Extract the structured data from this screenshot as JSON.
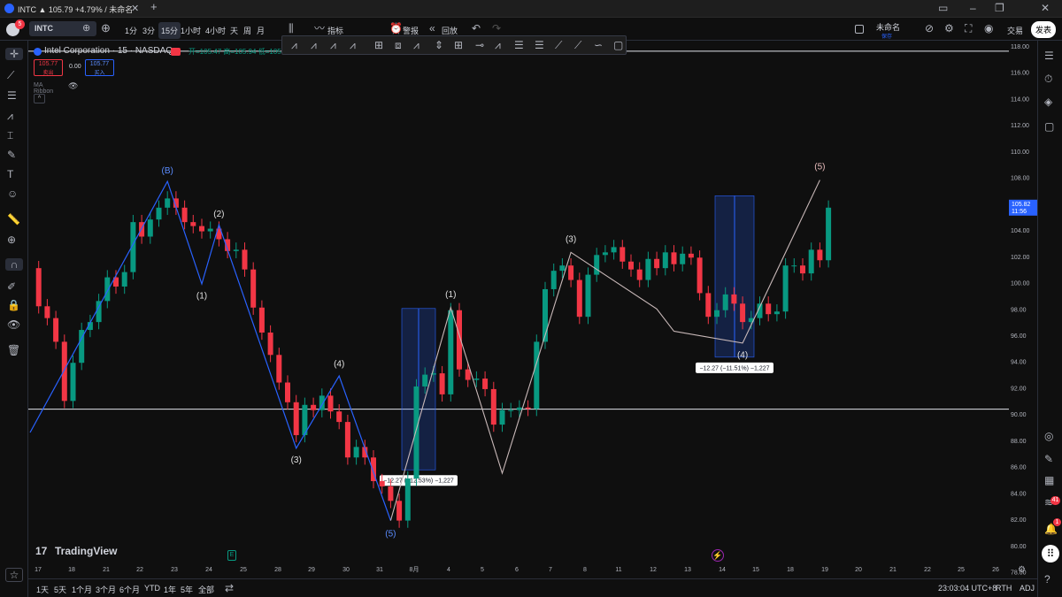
{
  "titlebar": {
    "tab_title": "INTC ▲ 105.79 +4.79% / 未命名",
    "logo": "tradingview-logo-icon"
  },
  "toolbar": {
    "symbol": "INTC",
    "notification_count": "5",
    "intervals": [
      "1分",
      "3分",
      "15分",
      "1小时",
      "4小时",
      "天",
      "周",
      "月"
    ],
    "active_interval": "15分",
    "indicators_label": "指标",
    "alert_label": "警报",
    "replay_label": "回放",
    "layout_name": "未命名",
    "layout_sub": "保存",
    "trade_label": "交易",
    "publish_label": "发表"
  },
  "legend": {
    "symbol_line": "Intel Corporation · 15 · NASDAQ",
    "ohlc": "开=105.47 高=105.94 低=105",
    "sell_price": "105.77",
    "sell_label": "卖出",
    "spread": "0.00",
    "buy_price": "105.77",
    "buy_label": "买入",
    "indicator": "MA Ribbon"
  },
  "chart": {
    "last_price": "105.82",
    "countdown": "11:56",
    "line_top_label": "117.60",
    "line_mid_label": "90.37",
    "measure1": "−12.27 (−12.53%) −1,227",
    "measure2": "−12.27 (−11.51%) −1,227",
    "wave_labels": {
      "B": "(B)",
      "w1a": "(1)",
      "w2": "(2)",
      "w3a": "(3)",
      "w4a": "(4)",
      "w5a": "(5)",
      "w1b": "(1)",
      "w3b": "(3)",
      "w4b": "(4)",
      "w5b": "(5)"
    },
    "watermark": "TradingView",
    "y_ticks": [
      "118.00",
      "116.00",
      "114.00",
      "112.00",
      "110.00",
      "108.00",
      "106.00",
      "104.00",
      "102.00",
      "100.00",
      "98.00",
      "96.00",
      "94.00",
      "92.00",
      "90.00",
      "88.00",
      "86.00",
      "84.00",
      "82.00",
      "80.00",
      "78.00"
    ],
    "x_ticks": [
      "17",
      "18",
      "21",
      "22",
      "23",
      "24",
      "25",
      "28",
      "29",
      "30",
      "31",
      "8月",
      "4",
      "5",
      "6",
      "7",
      "8",
      "11",
      "12",
      "13",
      "14",
      "15",
      "18",
      "19",
      "20",
      "21",
      "22",
      "25",
      "26"
    ]
  },
  "chart_data": {
    "type": "candlestick",
    "title": "Intel Corporation · 15 · NASDAQ",
    "xlabel": "",
    "ylabel": "",
    "ylim": [
      77.5,
      118.4
    ],
    "horizontal_lines": [
      117.6,
      90.37
    ],
    "series": [
      {
        "name": "wave_path",
        "values": [
          [
            0,
            88.6
          ],
          [
            8,
            107.7
          ],
          [
            10,
            99.9
          ],
          [
            11,
            104.4
          ],
          [
            15.5,
            87.4
          ],
          [
            18,
            92.9
          ],
          [
            21,
            81.9
          ],
          [
            24.5,
            98.1
          ],
          [
            27.5,
            85.5
          ],
          [
            31.5,
            102.3
          ],
          [
            36.5,
            98.0
          ],
          [
            37.5,
            96.3
          ],
          [
            41.5,
            95.4
          ],
          [
            46,
            107.8
          ]
        ]
      },
      {
        "name": "price",
        "values": [
          [
            0,
            101.1
          ],
          [
            0.5,
            98.2
          ],
          [
            1,
            97.3
          ],
          [
            1.5,
            95.5
          ],
          [
            2,
            91.0
          ],
          [
            2.5,
            93.9
          ],
          [
            3,
            96.4
          ],
          [
            3.5,
            97.0
          ],
          [
            4,
            98.6
          ],
          [
            4.5,
            100.4
          ],
          [
            5,
            99.7
          ],
          [
            5.5,
            100.8
          ],
          [
            6,
            104.6
          ],
          [
            6.5,
            103.5
          ],
          [
            7,
            104.8
          ],
          [
            7.5,
            105.7
          ],
          [
            8,
            106.4
          ],
          [
            8.5,
            105.7
          ],
          [
            9,
            104.6
          ],
          [
            9.5,
            104.3
          ],
          [
            10,
            103.9
          ],
          [
            10.5,
            104.1
          ],
          [
            11,
            103.3
          ],
          [
            11.5,
            102.4
          ],
          [
            12,
            102.5
          ],
          [
            12.5,
            101.0
          ],
          [
            13,
            98.1
          ],
          [
            13.5,
            96.2
          ],
          [
            14,
            94.5
          ],
          [
            14.5,
            92.4
          ],
          [
            15,
            90.9
          ],
          [
            15.5,
            88.4
          ],
          [
            16,
            90.7
          ],
          [
            16.5,
            90.3
          ],
          [
            17,
            91.4
          ],
          [
            17.5,
            90.2
          ],
          [
            18,
            89.4
          ],
          [
            18.5,
            86.7
          ],
          [
            19,
            87.5
          ],
          [
            19.5,
            86.7
          ],
          [
            20,
            84.9
          ],
          [
            20.5,
            84.5
          ],
          [
            21,
            83.4
          ],
          [
            21.5,
            81.9
          ],
          [
            22,
            85.1
          ],
          [
            22.5,
            92.1
          ],
          [
            23,
            93.0
          ],
          [
            23.5,
            93.1
          ],
          [
            24,
            91.5
          ],
          [
            24.5,
            97.9
          ],
          [
            25,
            93.4
          ],
          [
            25.5,
            92.6
          ],
          [
            26,
            92.7
          ],
          [
            26.5,
            91.9
          ],
          [
            27,
            89.2
          ],
          [
            27.5,
            90.3
          ],
          [
            28,
            90.3
          ],
          [
            28.5,
            90.5
          ],
          [
            29,
            90.4
          ],
          [
            29.5,
            95.5
          ],
          [
            30,
            99.5
          ],
          [
            30.5,
            100.9
          ],
          [
            31,
            101.3
          ],
          [
            31.5,
            100.2
          ],
          [
            32,
            97.4
          ],
          [
            32.5,
            100.6
          ],
          [
            33,
            102.1
          ],
          [
            33.5,
            102.3
          ],
          [
            34,
            102.7
          ],
          [
            34.5,
            101.6
          ],
          [
            35,
            101.0
          ],
          [
            35.5,
            100.2
          ],
          [
            36,
            101.8
          ],
          [
            36.5,
            101.1
          ],
          [
            37,
            102.3
          ],
          [
            37.5,
            101.4
          ],
          [
            38,
            102.2
          ],
          [
            38.5,
            101.9
          ],
          [
            39,
            99.2
          ],
          [
            39.5,
            97.4
          ],
          [
            40,
            97.9
          ],
          [
            40.5,
            99.1
          ],
          [
            41,
            98.4
          ],
          [
            41.5,
            97.0
          ],
          [
            42,
            97.3
          ],
          [
            42.5,
            98.4
          ],
          [
            43,
            97.6
          ],
          [
            43.5,
            97.8
          ],
          [
            44,
            101.3
          ],
          [
            44.5,
            101.3
          ],
          [
            45,
            100.7
          ],
          [
            45.5,
            102.5
          ],
          [
            46,
            101.7
          ],
          [
            46.5,
            105.7
          ]
        ]
      }
    ],
    "measures": [
      {
        "from": 98.03,
        "to": 85.76,
        "label": "−12.27 (−12.53%) −1,227"
      },
      {
        "from": 106.6,
        "to": 94.33,
        "label": "−12.27 (−11.51%) −1,227"
      }
    ]
  },
  "bottombar": {
    "ranges": [
      "1天",
      "5天",
      "1个月",
      "3个月",
      "6个月",
      "YTD",
      "1年",
      "5年",
      "全部"
    ],
    "clock": "23:03:04 UTC+8",
    "session": "RTH",
    "adj": "ADJ"
  }
}
